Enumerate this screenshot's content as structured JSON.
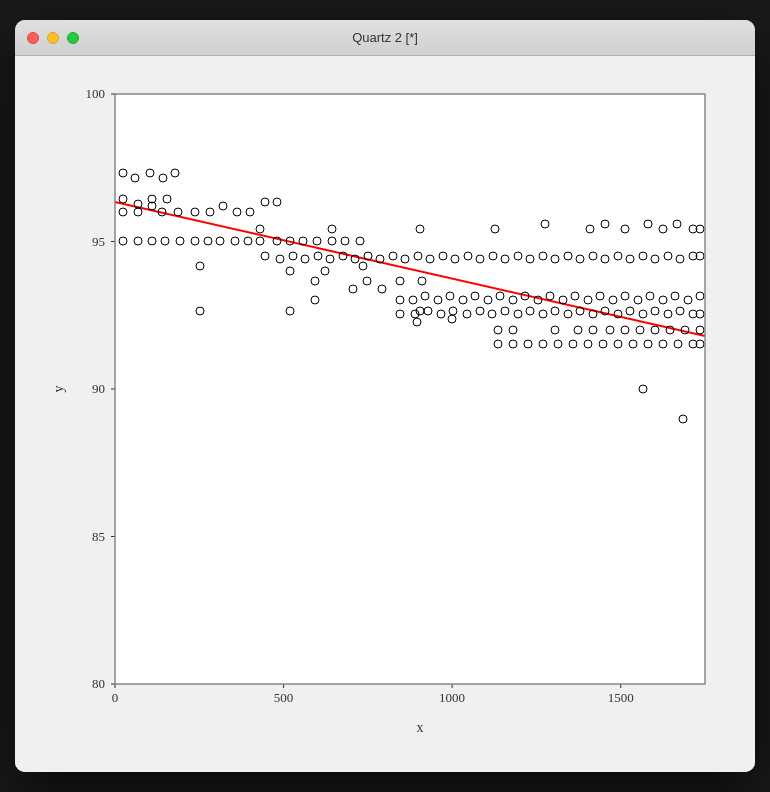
{
  "window": {
    "title": "Quartz 2 [*]"
  },
  "chart": {
    "x_label": "x",
    "y_label": "y",
    "x_axis": {
      "min": 0,
      "max": 1750,
      "ticks": [
        0,
        500,
        1000,
        1500
      ]
    },
    "y_axis": {
      "min": 80,
      "max": 100,
      "ticks": [
        80,
        85,
        90,
        95,
        100
      ]
    }
  }
}
